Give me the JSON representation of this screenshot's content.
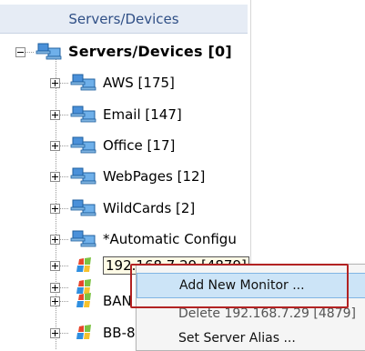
{
  "header": {
    "title": "Servers/Devices"
  },
  "tree": {
    "root": {
      "label": "Servers/Devices [0]"
    },
    "groups": [
      {
        "label": "AWS [175]"
      },
      {
        "label": "Email [147]"
      },
      {
        "label": "Office [17]"
      },
      {
        "label": "WebPages [12]"
      },
      {
        "label": "WildCards [2]"
      },
      {
        "label": "*Automatic Configu"
      }
    ],
    "servers": [
      {
        "label": "192.168.7.29 [4879]"
      },
      {
        "label": ""
      },
      {
        "label": "BAN"
      },
      {
        "label": "BB-8"
      }
    ]
  },
  "context_menu": {
    "items": [
      {
        "label": "Add New Monitor ..."
      },
      {
        "label": "Delete 192.168.7.29 [4879]"
      },
      {
        "label": "Set Server Alias ..."
      }
    ]
  },
  "colors": {
    "header_bg": "#e6ecf5",
    "header_text": "#2f4f86",
    "highlight_border": "#b22222",
    "menu_hover": "#cce4f7"
  },
  "icons": {
    "group": "network-computers-icon",
    "server": "windows-logo-icon"
  }
}
